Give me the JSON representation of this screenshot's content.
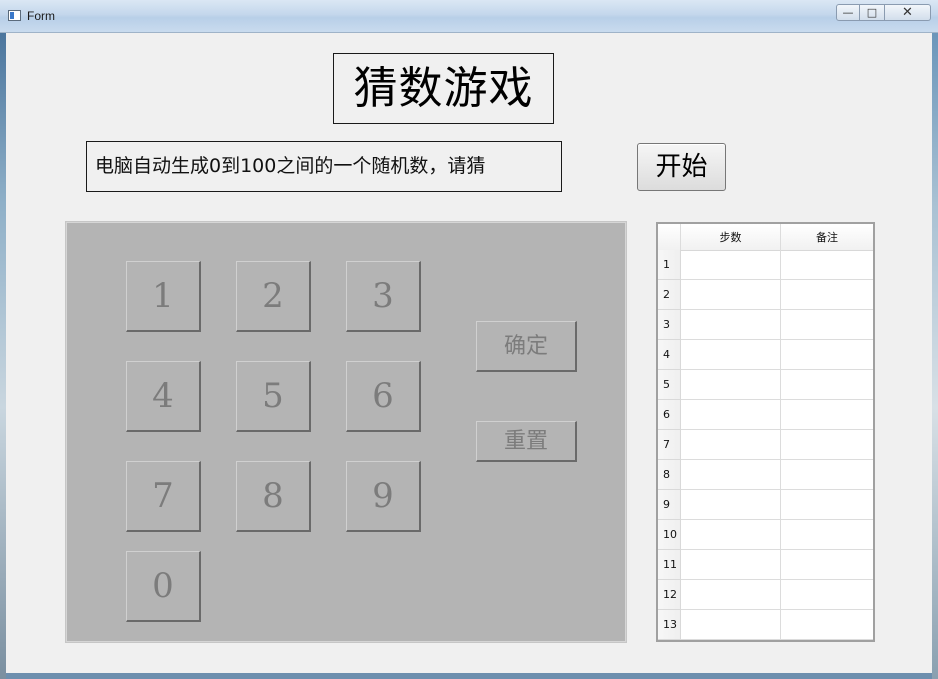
{
  "window": {
    "title": "Form",
    "minimize_glyph": "—",
    "maximize_glyph": "□",
    "close_glyph": "✕"
  },
  "game": {
    "title": "猜数游戏",
    "hint": "电脑自动生成0到100之间的一个随机数，请猜",
    "start_label": "开始"
  },
  "keypad": {
    "keys": [
      "1",
      "2",
      "3",
      "4",
      "5",
      "6",
      "7",
      "8",
      "9",
      "0"
    ],
    "confirm_label": "确定",
    "reset_label": "重置"
  },
  "history": {
    "columns": [
      "步数",
      "备注"
    ],
    "rows": [
      "1",
      "2",
      "3",
      "4",
      "5",
      "6",
      "7",
      "8",
      "9",
      "10",
      "11",
      "12",
      "13"
    ]
  }
}
